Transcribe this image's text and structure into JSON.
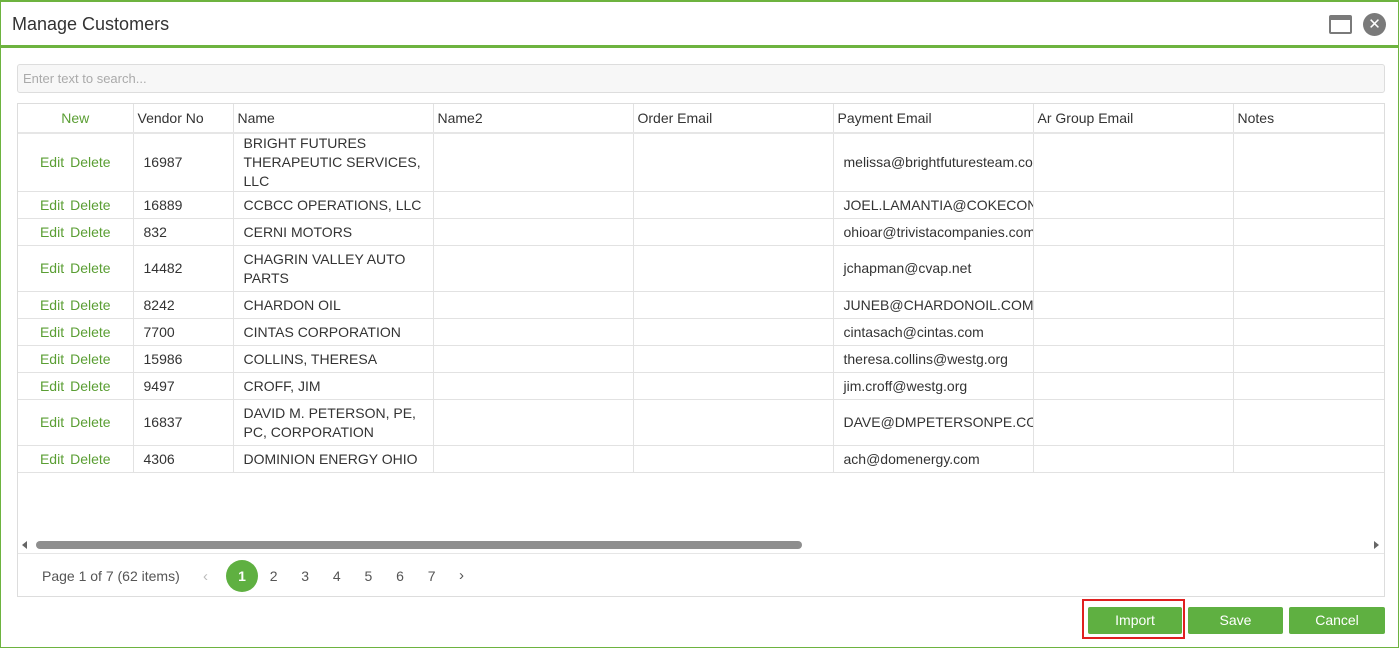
{
  "window": {
    "title": "Manage Customers",
    "icons": [
      "maximize-icon",
      "close-icon"
    ],
    "close_glyph": "✕"
  },
  "search": {
    "placeholder": "Enter text to search..."
  },
  "grid": {
    "columns": [
      "New",
      "Vendor No",
      "Name",
      "Name2",
      "Order Email",
      "Payment Email",
      "Ar Group Email",
      "Notes"
    ],
    "row_actions": {
      "edit": "Edit",
      "delete": "Delete"
    },
    "rows": [
      {
        "vendor_no": "16987",
        "name": "BRIGHT FUTURES THERAPEUTIC SERVICES, LLC",
        "name2": "",
        "order_email": "",
        "payment_email": "melissa@brightfuturesteam.com",
        "ar_group_email": "",
        "notes": ""
      },
      {
        "vendor_no": "16889",
        "name": "CCBCC OPERATIONS, LLC",
        "name2": "",
        "order_email": "",
        "payment_email": "JOEL.LAMANTIA@COKECONSOL",
        "ar_group_email": "",
        "notes": ""
      },
      {
        "vendor_no": "832",
        "name": "CERNI MOTORS",
        "name2": "",
        "order_email": "",
        "payment_email": "ohioar@trivistacompanies.com",
        "ar_group_email": "",
        "notes": ""
      },
      {
        "vendor_no": "14482",
        "name": "CHAGRIN VALLEY AUTO PARTS",
        "name2": "",
        "order_email": "",
        "payment_email": "jchapman@cvap.net",
        "ar_group_email": "",
        "notes": ""
      },
      {
        "vendor_no": "8242",
        "name": "CHARDON OIL",
        "name2": "",
        "order_email": "",
        "payment_email": "JUNEB@CHARDONOIL.COM",
        "ar_group_email": "",
        "notes": ""
      },
      {
        "vendor_no": "7700",
        "name": "CINTAS CORPORATION",
        "name2": "",
        "order_email": "",
        "payment_email": "cintasach@cintas.com",
        "ar_group_email": "",
        "notes": ""
      },
      {
        "vendor_no": "15986",
        "name": "COLLINS, THERESA",
        "name2": "",
        "order_email": "",
        "payment_email": "theresa.collins@westg.org",
        "ar_group_email": "",
        "notes": ""
      },
      {
        "vendor_no": "9497",
        "name": "CROFF, JIM",
        "name2": "",
        "order_email": "",
        "payment_email": "jim.croff@westg.org",
        "ar_group_email": "",
        "notes": ""
      },
      {
        "vendor_no": "16837",
        "name": "DAVID M. PETERSON, PE, PC, CORPORATION",
        "name2": "",
        "order_email": "",
        "payment_email": "DAVE@DMPETERSONPE.COM",
        "ar_group_email": "",
        "notes": ""
      },
      {
        "vendor_no": "4306",
        "name": "DOMINION ENERGY OHIO",
        "name2": "",
        "order_email": "",
        "payment_email": "ach@domenergy.com",
        "ar_group_email": "",
        "notes": ""
      }
    ]
  },
  "pager": {
    "info": "Page 1 of 7 (62 items)",
    "prev": "‹",
    "next": "›",
    "pages": [
      "1",
      "2",
      "3",
      "4",
      "5",
      "6",
      "7"
    ],
    "current_page": "1"
  },
  "buttons": {
    "import": "Import",
    "save": "Save",
    "cancel": "Cancel"
  },
  "colors": {
    "accent": "#5fb041",
    "highlight": "#e02020"
  }
}
